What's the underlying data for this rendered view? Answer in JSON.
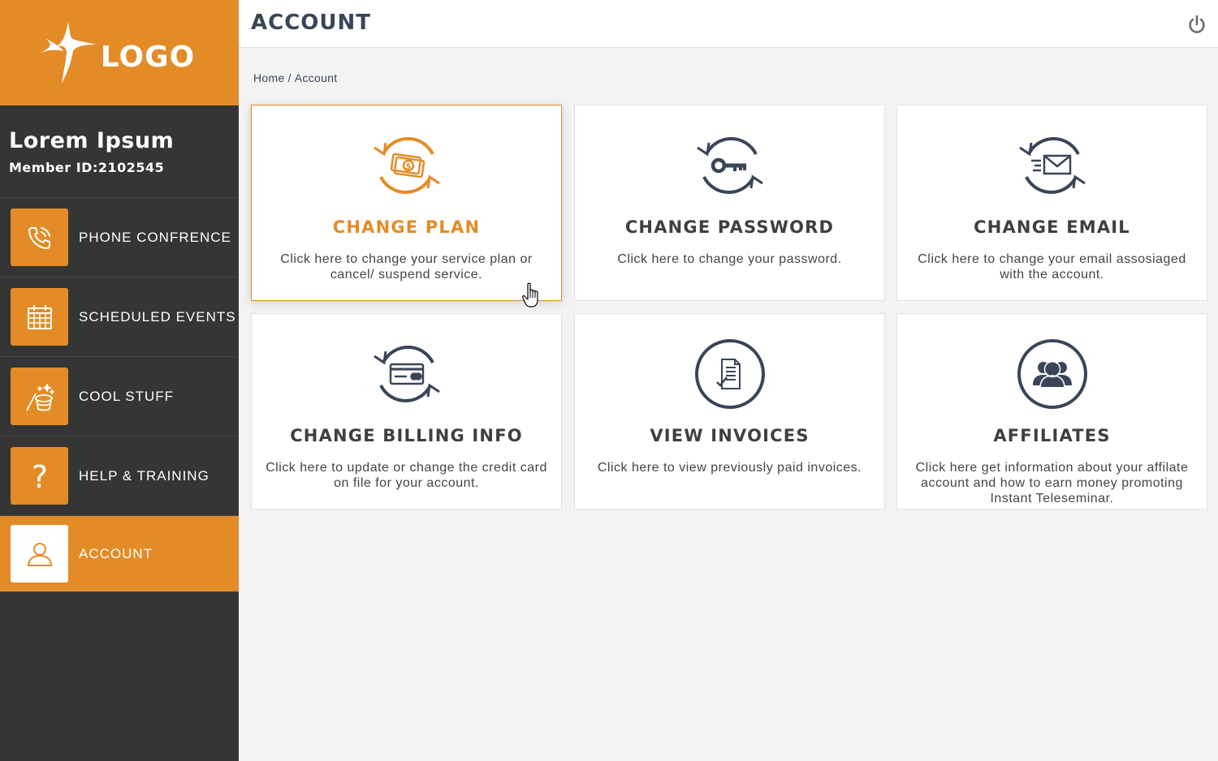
{
  "logo": {
    "text": "LOGO"
  },
  "user": {
    "name": "Lorem Ipsum",
    "member_id": "Member ID:2102545"
  },
  "nav": [
    {
      "label": "PHONE CONFRENCE",
      "icon": "phone-icon"
    },
    {
      "label": "SCHEDULED EVENTS",
      "icon": "calendar-icon"
    },
    {
      "label": "COOL STUFF",
      "icon": "magic-hat-icon"
    },
    {
      "label": "HELP & TRAINING",
      "icon": "question-icon"
    },
    {
      "label": "ACCOUNT",
      "icon": "user-icon",
      "active": true
    }
  ],
  "header": {
    "title": "ACCOUNT",
    "power_icon": "power-icon"
  },
  "breadcrumb": {
    "home": "Home",
    "separator": "/",
    "current": "Account"
  },
  "cards": [
    {
      "title": "CHANGE PLAN",
      "desc": "Click here to change your service plan or cancel/ suspend service.",
      "icon": "money-refresh-icon",
      "active": true
    },
    {
      "title": "CHANGE PASSWORD",
      "desc": "Click here to change your password.",
      "icon": "key-refresh-icon"
    },
    {
      "title": "CHANGE EMAIL",
      "desc": "Click here to change your email assosiaged with the account.",
      "icon": "envelope-refresh-icon"
    },
    {
      "title": "CHANGE BILLING INFO",
      "desc": "Click here to update or change the credit card on file for your account.",
      "icon": "credit-card-refresh-icon"
    },
    {
      "title": "VIEW INVOICES",
      "desc": "Click here to view previously paid invoices.",
      "icon": "invoice-icon"
    },
    {
      "title": "AFFILIATES",
      "desc": "Click here get information about your affilate account and how to earn money promoting Instant Teleseminar.",
      "icon": "people-icon"
    }
  ],
  "colors": {
    "accent": "#e38c27",
    "sidebar": "#353535",
    "dark_text": "#3a4558",
    "background": "#f3f3f3"
  }
}
